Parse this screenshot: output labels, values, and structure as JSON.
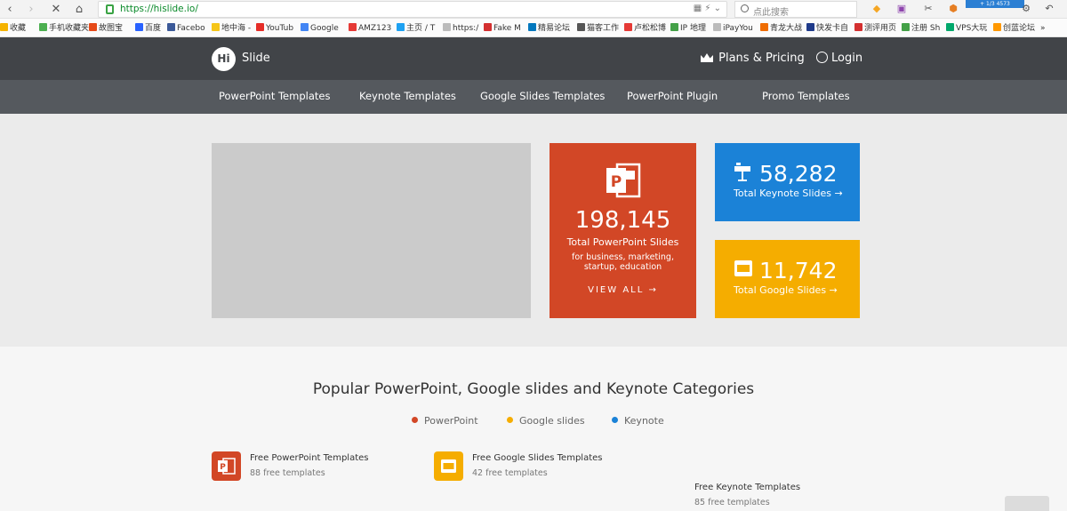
{
  "browser": {
    "url": "https://hislide.io/",
    "search_placeholder": "点此搜索",
    "ext_badge": "+ 1/3 4573",
    "bookmarks": [
      {
        "label": "收藏",
        "color": "#f5b300"
      },
      {
        "label": "手机收藏夹",
        "color": "#4caf50"
      },
      {
        "label": "故图宝",
        "color": "#e64a19"
      },
      {
        "label": "百度",
        "color": "#2962ff"
      },
      {
        "label": "Facebo",
        "color": "#3b5998"
      },
      {
        "label": "地中海 -",
        "color": "#f5c518"
      },
      {
        "label": "YouTub",
        "color": "#e52d27"
      },
      {
        "label": "Google",
        "color": "#4285f4"
      },
      {
        "label": "AMZ123",
        "color": "#e53935"
      },
      {
        "label": "主页 / T",
        "color": "#1da1f2"
      },
      {
        "label": "https:/",
        "color": "#bbbbbb"
      },
      {
        "label": "Fake M",
        "color": "#d32f2f"
      },
      {
        "label": "精易论坛",
        "color": "#0277bd"
      },
      {
        "label": "猫客工作",
        "color": "#555555"
      },
      {
        "label": "卢松松博",
        "color": "#e53935"
      },
      {
        "label": "IP 地理",
        "color": "#43a047"
      },
      {
        "label": "iPayYou",
        "color": "#bbbbbb"
      },
      {
        "label": "青龙大战",
        "color": "#ef6c00"
      },
      {
        "label": "快发卡自",
        "color": "#1e3a8a"
      },
      {
        "label": "测评用页",
        "color": "#d32f2f"
      },
      {
        "label": "注册 Sh",
        "color": "#43a047"
      },
      {
        "label": "VPS大玩",
        "color": "#00a86b"
      },
      {
        "label": "创蓝论坛",
        "color": "#ff9800"
      },
      {
        "label": "»",
        "color": ""
      }
    ]
  },
  "header": {
    "logo_mark": "Hi",
    "logo_text": "Slide",
    "plans": "Plans & Pricing",
    "login": "Login"
  },
  "nav": [
    "PowerPoint Templates",
    "Keynote Templates",
    "Google Slides Templates",
    "PowerPoint Plugin",
    "Promo Templates"
  ],
  "hero": {
    "ppt": {
      "count": "198,145",
      "label": "Total PowerPoint Slides",
      "desc": "for business, marketing, startup, education",
      "cta": "VIEW ALL →",
      "color": "#d24726"
    },
    "keynote": {
      "count": "58,282",
      "label": "Total Keynote Slides →",
      "color": "#1b82d7"
    },
    "google": {
      "count": "11,742",
      "label": "Total Google Slides →",
      "color": "#f5ad00"
    }
  },
  "categories": {
    "title": "Popular PowerPoint, Google slides and Keynote Categories",
    "legend": [
      {
        "label": "PowerPoint",
        "color": "#d24726"
      },
      {
        "label": "Google slides",
        "color": "#f5ad00"
      },
      {
        "label": "Keynote",
        "color": "#1b82d7"
      }
    ],
    "items": [
      {
        "name": "Free PowerPoint Templates",
        "count": "88 free templates"
      },
      {
        "name": "Free Google Slides Templates",
        "count": "42 free templates"
      },
      {
        "name": "Free Keynote Templates",
        "count": "85 free templates"
      }
    ]
  }
}
